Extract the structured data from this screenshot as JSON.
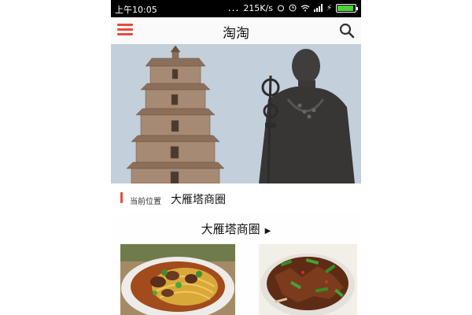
{
  "status_bar": {
    "time": "上午10:05",
    "dots": "...",
    "speed": "215K/s",
    "battery_level": 0.9
  },
  "header": {
    "title": "淘淘",
    "menu_icon": "menu-icon",
    "search_icon": "search-icon"
  },
  "banner": {
    "slides": 3,
    "active_slide": 1
  },
  "location": {
    "label": "当前位置",
    "value": "大雁塔商圈"
  },
  "section": {
    "title": "大雁塔商圈",
    "arrow": "▶"
  },
  "colors": {
    "accent": "#e74c3c",
    "status_bar": "#000000"
  }
}
